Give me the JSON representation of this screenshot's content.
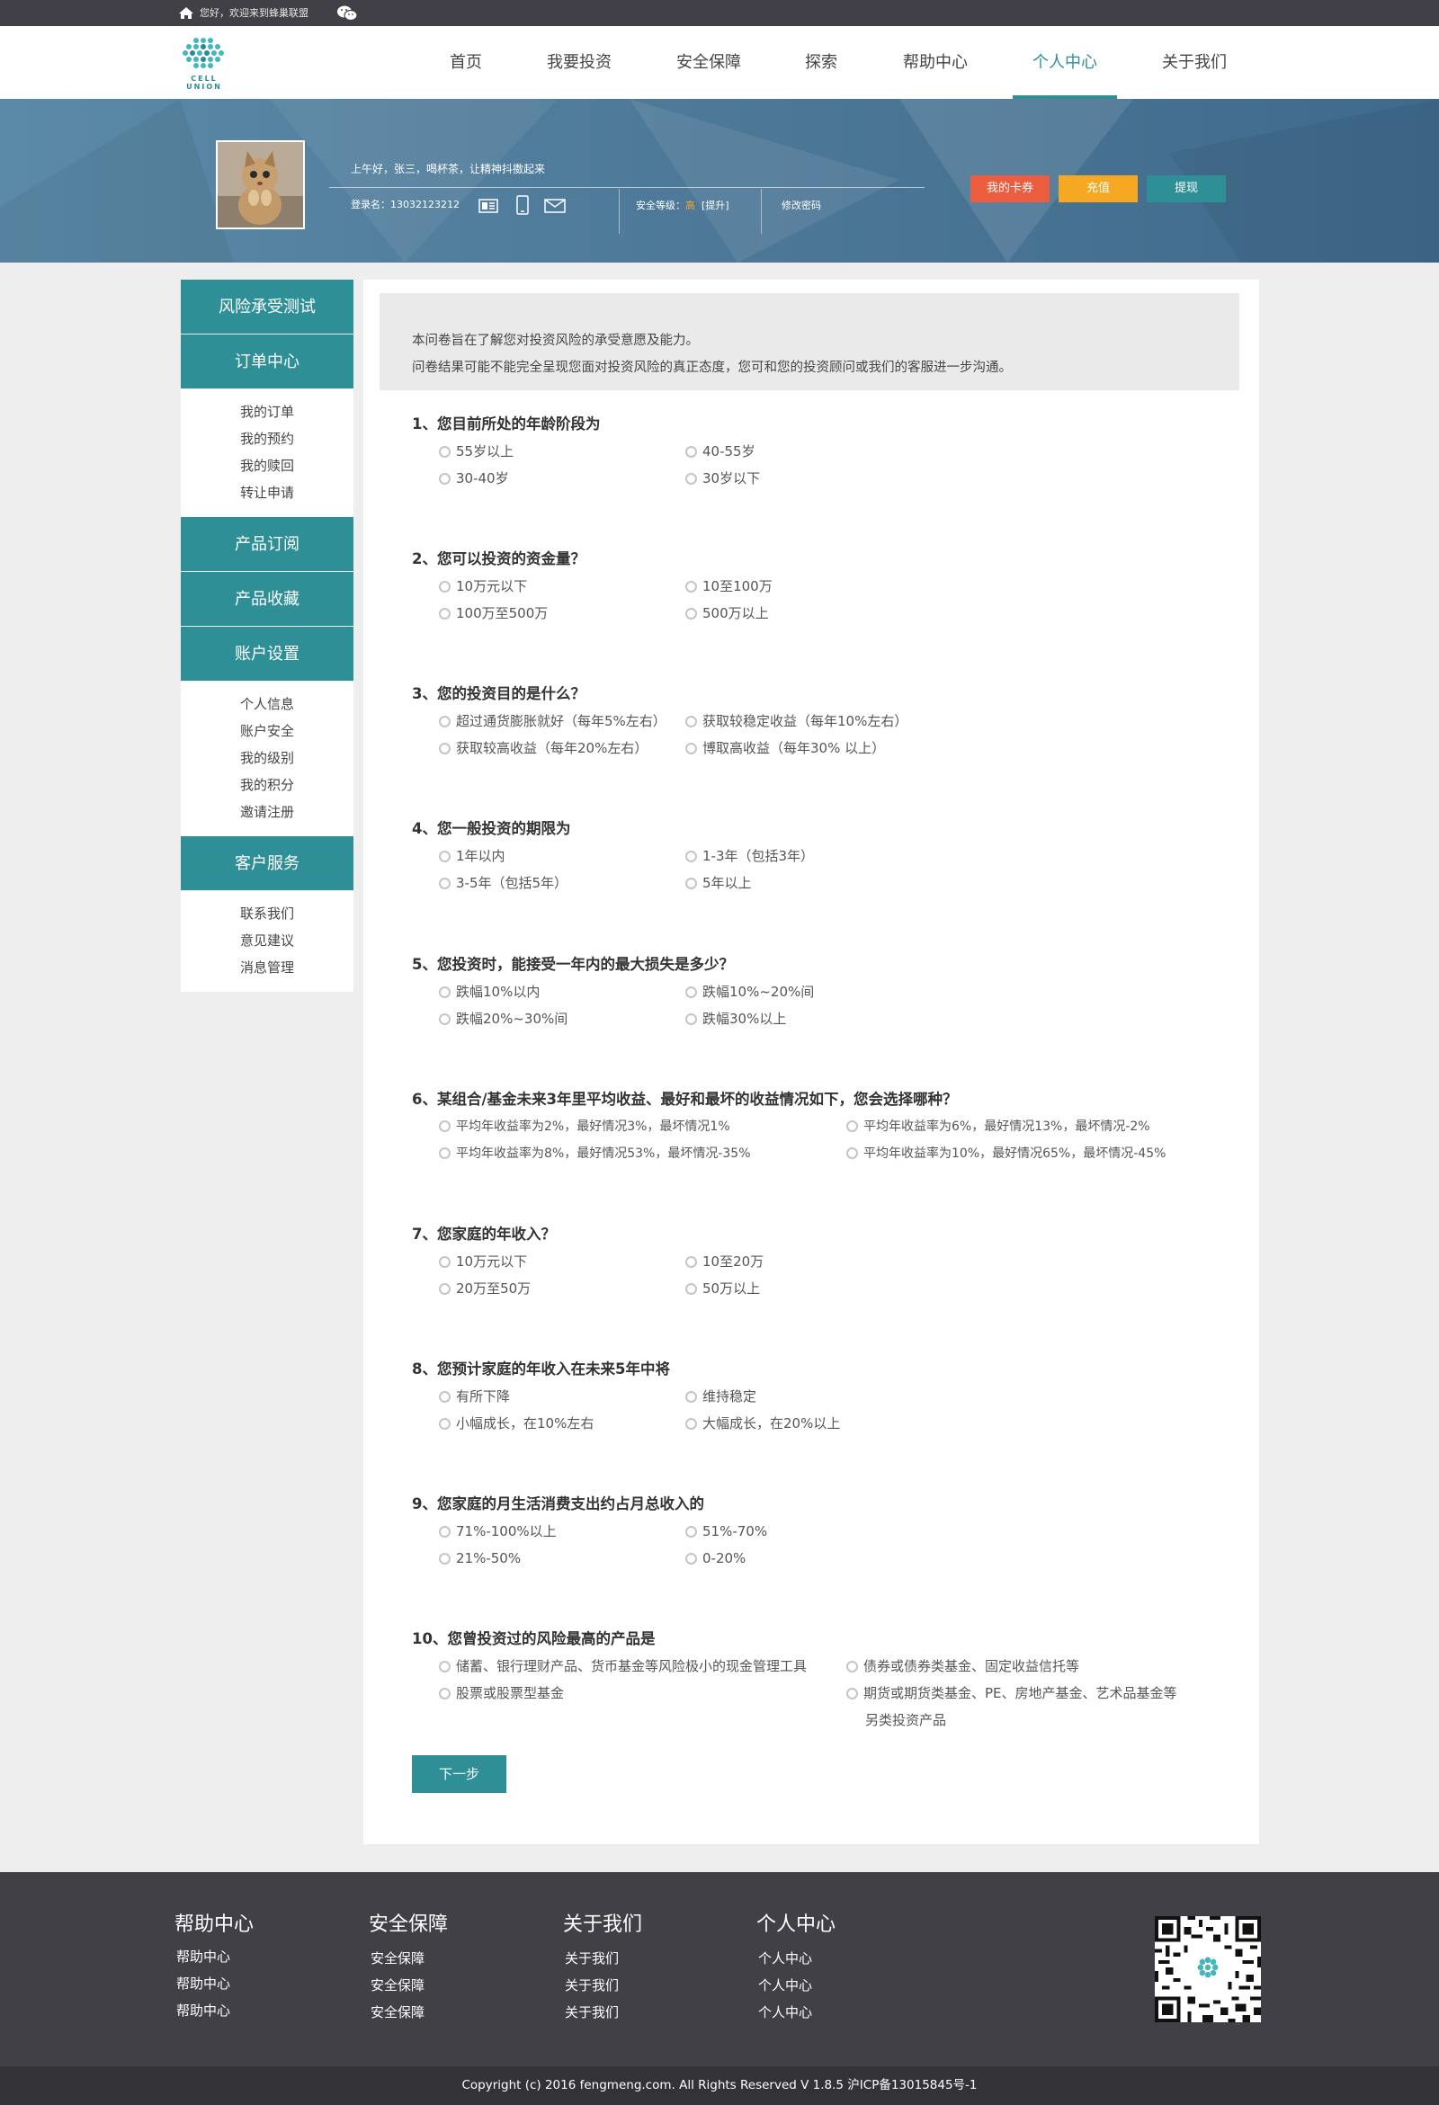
{
  "topbar": {
    "greeting": "您好，欢迎来到蜂巢联盟"
  },
  "logo": {
    "line1": "CELL",
    "line2": "UNION"
  },
  "nav": {
    "items": [
      {
        "label": "首页"
      },
      {
        "label": "我要投资"
      },
      {
        "label": "安全保障"
      },
      {
        "label": "探索"
      },
      {
        "label": "帮助中心"
      },
      {
        "label": "个人中心"
      },
      {
        "label": "关于我们"
      }
    ],
    "active_index": 5
  },
  "banner": {
    "hello": "上午好，张三，喝杯茶，让精神抖擞起来",
    "login_label": "登录名：",
    "login_value": "13032123212",
    "security_label": "安全等级：",
    "security_level": "高",
    "security_upgrade": "[提升]",
    "change_password": "修改密码",
    "btn_card": "我的卡券",
    "btn_recharge": "充值",
    "btn_withdraw": "提现"
  },
  "sidebar": {
    "sections": [
      {
        "title": "风险承受测试",
        "items": []
      },
      {
        "title": "订单中心",
        "items": [
          "我的订单",
          "我的预约",
          "我的赎回",
          "转让申请"
        ]
      },
      {
        "title": "产品订阅",
        "items": []
      },
      {
        "title": "产品收藏",
        "items": []
      },
      {
        "title": "账户设置",
        "items": [
          "个人信息",
          "账户安全",
          "我的级别",
          "我的积分",
          "邀请注册"
        ]
      },
      {
        "title": "客户服务",
        "items": [
          "联系我们",
          "意见建议",
          "消息管理"
        ]
      }
    ]
  },
  "intro": {
    "line1": "本问卷旨在了解您对投资风险的承受意愿及能力。",
    "line2": "问卷结果可能不能完全呈现您面对投资风险的真正态度，您可和您的投资顾问或我们的客服进一步沟通。"
  },
  "questions": [
    {
      "title": "1、您目前所处的年龄阶段为",
      "options": [
        "55岁以上",
        "40-55岁",
        "30-40岁",
        "30岁以下"
      ]
    },
    {
      "title": "2、您可以投资的资金量？",
      "options": [
        "10万元以下",
        "10至100万",
        "100万至500万",
        "500万以上"
      ]
    },
    {
      "title": "3、您的投资目的是什么？",
      "options": [
        "超过通货膨胀就好（每年5%左右）",
        "获取较稳定收益（每年10%左右）",
        "获取较高收益（每年20%左右）",
        "博取高收益（每年30% 以上）"
      ]
    },
    {
      "title": "4、您一般投资的期限为",
      "options": [
        "1年以内",
        "1-3年（包括3年）",
        "3-5年（包括5年）",
        "5年以上"
      ]
    },
    {
      "title": "5、您投资时，能接受一年内的最大损失是多少？",
      "options": [
        "跌幅10%以内",
        "跌幅10%~20%间",
        "跌幅20%~30%间",
        "跌幅30%以上"
      ]
    },
    {
      "title": "6、某组合/基金未来3年里平均收益、最好和最坏的收益情况如下，您会选择哪种？",
      "options": [
        "平均年收益率为2%，最好情况3%，最坏情况1%",
        "平均年收益率为6%，最好情况13%，最坏情况-2%",
        "平均年收益率为8%，最好情况53%，最坏情况-35%",
        "平均年收益率为10%，最好情况65%，最坏情况-45%"
      ]
    },
    {
      "title": "7、您家庭的年收入？",
      "options": [
        "10万元以下",
        "10至20万",
        "20万至50万",
        "50万以上"
      ]
    },
    {
      "title": "8、您预计家庭的年收入在未来5年中将",
      "options": [
        "有所下降",
        "维持稳定",
        "小幅成长，在10%左右",
        "大幅成长，在20%以上"
      ]
    },
    {
      "title": "9、您家庭的月生活消费支出约占月总收入的",
      "options": [
        "71%-100%以上",
        "51%-70%",
        "21%-50%",
        "0-20%"
      ]
    },
    {
      "title": "10、您曾投资过的风险最高的产品是",
      "options": [
        "储蓄、银行理财产品、货币基金等风险极小的现金管理工具",
        "债券或债券类基金、固定收益信托等",
        "股票或股票型基金",
        "期货或期货类基金、PE、房地产基金、艺术品基金等",
        "另类投资产品"
      ]
    }
  ],
  "next_button": "下一步",
  "footer": {
    "columns": [
      {
        "title": "帮助中心",
        "links": [
          "帮助中心",
          "帮助中心",
          "帮助中心"
        ]
      },
      {
        "title": "安全保障",
        "links": [
          "安全保障",
          "安全保障",
          "安全保障"
        ]
      },
      {
        "title": "关于我们",
        "links": [
          "关于我们",
          "关于我们",
          "关于我们"
        ]
      },
      {
        "title": "个人中心",
        "links": [
          "个人中心",
          "个人中心",
          "个人中心"
        ]
      }
    ],
    "copyright": "Copyright (c) 2016 fengmeng.com. All Rights Reserved V 1.8.5 沪ICP备13015845号-1"
  },
  "colors": {
    "accent": "#2f8f97",
    "red": "#ec5d3f",
    "yellow": "#f7a823",
    "dark": "#414046"
  }
}
